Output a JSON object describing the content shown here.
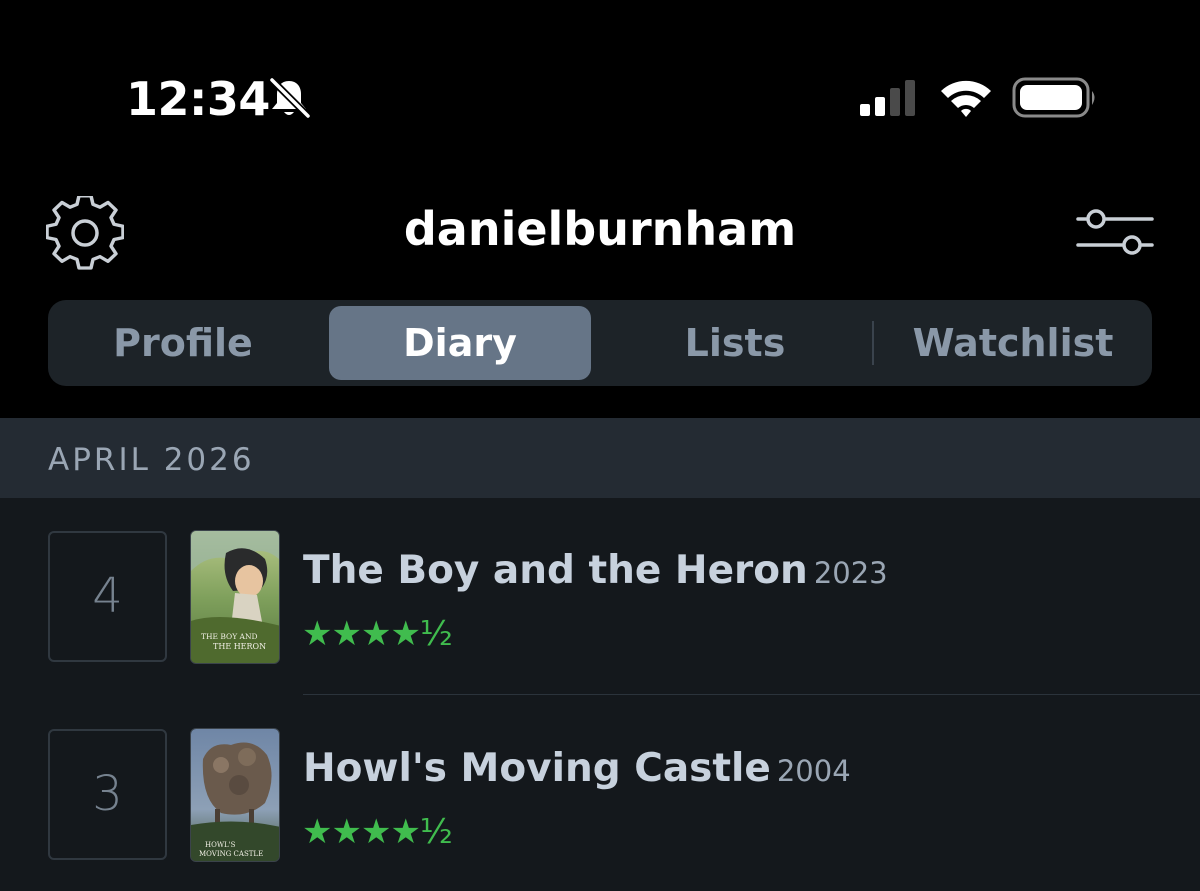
{
  "status_bar": {
    "time": "12:34",
    "icons": [
      "bell-slash-icon",
      "cellular-signal-icon",
      "wifi-icon",
      "battery-icon"
    ]
  },
  "header": {
    "username": "danielburnham",
    "left_icon": "gear-icon",
    "right_icon": "sliders-icon"
  },
  "tabs": [
    {
      "label": "Profile",
      "active": false
    },
    {
      "label": "Diary",
      "active": true
    },
    {
      "label": "Lists",
      "active": false
    },
    {
      "label": "Watchlist",
      "active": false
    }
  ],
  "diary": {
    "month": "APRIL 2026",
    "entries": [
      {
        "day": "4",
        "title": "The Boy and the Heron",
        "year": "2023",
        "rating_stars": "★★★★½",
        "rating_value": 4.5,
        "poster": {
          "text_line1": "THE BOY AND",
          "text_line2": "THE HERON"
        }
      },
      {
        "day": "3",
        "title": "Howl's Moving Castle",
        "year": "2004",
        "rating_stars": "★★★★½",
        "rating_value": 4.5,
        "poster": {
          "text_line1": "HOWL'S",
          "text_line2": "MOVING CASTLE"
        }
      }
    ]
  },
  "colors": {
    "background": "#000000",
    "content_bg": "#14181c",
    "month_header_bg": "#242b33",
    "tab_active": "#667587",
    "tab_text": "#8a98a8",
    "star_green": "#40bc4e",
    "title_text": "#c7d1dd"
  }
}
